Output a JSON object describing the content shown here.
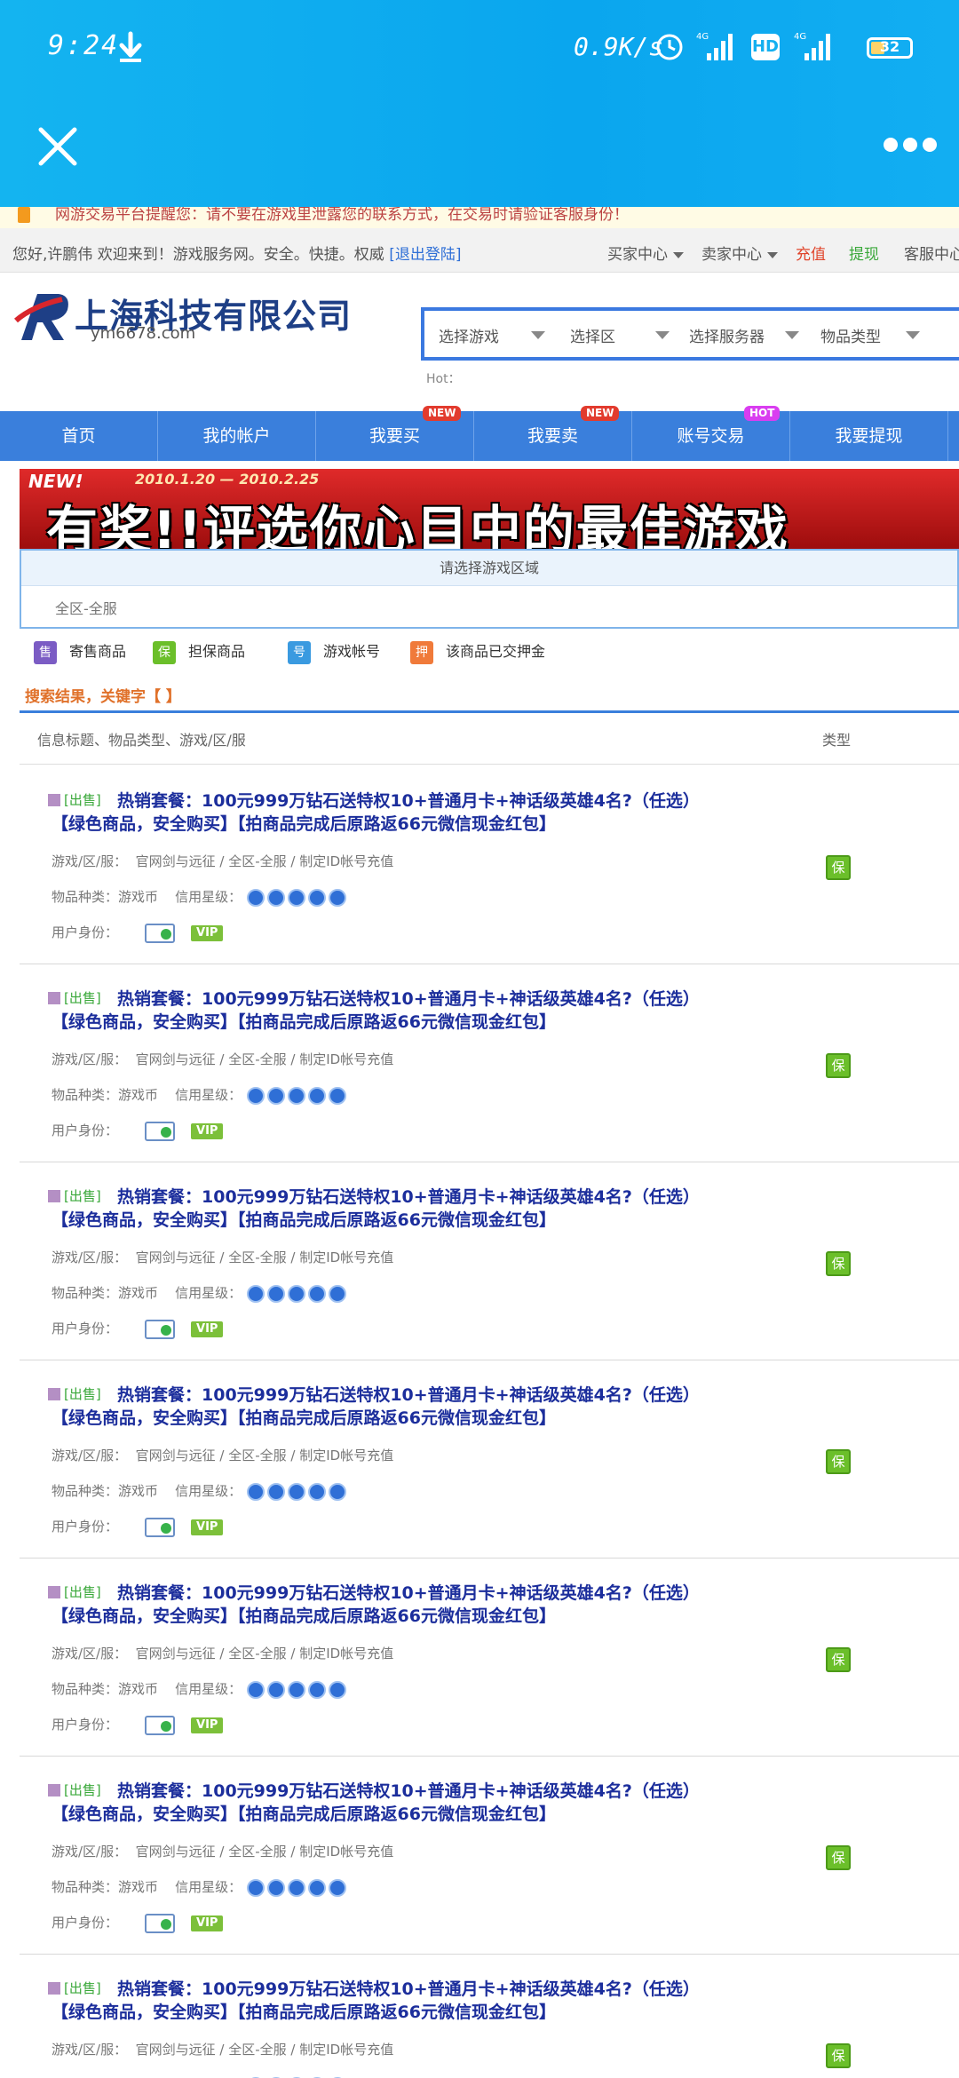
{
  "status": {
    "time": "9:24",
    "speed": "0.9K/s",
    "network": "4G",
    "hd": "HD",
    "battery_level": 0.35,
    "battery_text": "32"
  },
  "notice": "网游交易平台提醒您：请不要在游戏里泄露您的联系方式，在交易时请验证客服身份！",
  "userbar": {
    "welcome": "您好,许鹏伟 欢迎来到！游戏服务网。安全。快捷。权威",
    "logout": "[退出登陆]",
    "links": [
      "买家中心",
      "卖家中心",
      "充值",
      "提现",
      "客服中心"
    ]
  },
  "logo": {
    "name": "上海科技有限公司",
    "domain": "ym6678.com"
  },
  "search": {
    "selects": [
      "选择游戏",
      "选择区",
      "选择服务器",
      "物品类型"
    ],
    "hot": "Hot："
  },
  "nav": [
    {
      "label": "首页",
      "badge": ""
    },
    {
      "label": "我的帐户",
      "badge": ""
    },
    {
      "label": "我要买",
      "badge": "NEW"
    },
    {
      "label": "我要卖",
      "badge": "NEW"
    },
    {
      "label": "账号交易",
      "badge": "HOT"
    },
    {
      "label": "我要提现",
      "badge": ""
    }
  ],
  "banner": {
    "new": "NEW!",
    "date": "2010.1.20 — 2010.2.25",
    "title": "有奖!!评选你心目中的最佳游戏"
  },
  "region": {
    "header": "请选择游戏区域",
    "value": "全区-全服"
  },
  "legend": [
    {
      "label": "寄售商品",
      "icon": "售",
      "color": "#7b5cc4"
    },
    {
      "label": "担保商品",
      "icon": "保",
      "color": "#6bbf2a"
    },
    {
      "label": "游戏帐号",
      "icon": "号",
      "color": "#3a9ae0"
    },
    {
      "label": "该商品已交押金",
      "icon": "押",
      "color": "#f07a3a"
    }
  ],
  "results": {
    "title": "搜索结果，关键字【 】",
    "col1": "信息标题、物品类型、游戏/区/服",
    "col2": "类型"
  },
  "listing_template": {
    "tag": "[出售]",
    "title1": "热销套餐：100元999万钻石送特权10+普通月卡+神话级英雄4名?（任选）",
    "title2": "【绿色商品，安全购买】【拍商品完成后原路返66元微信现金红包】",
    "server_label": "游戏/区/服：",
    "server_value": "官网剑与远征 / 全区-全服 / 制定ID帐号充值",
    "item_label": "物品种类：",
    "item_value": "游戏币",
    "credit_label": "信用星级：",
    "identity_label": "用户身份：",
    "vip": "VIP",
    "type_icon": "保"
  },
  "listing_count": 7
}
